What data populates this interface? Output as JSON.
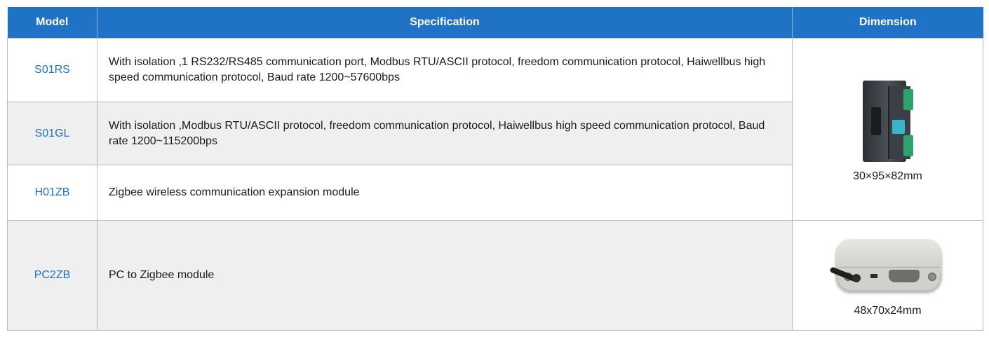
{
  "table": {
    "headers": {
      "model": "Model",
      "specification": "Specification",
      "dimension": "Dimension"
    },
    "rows": [
      {
        "model": "S01RS",
        "spec": "With isolation ,1 RS232/RS485 communication port, Modbus RTU/ASCII protocol, freedom communication protocol, Haiwellbus high speed communication protocol, Baud rate 1200~57600bps"
      },
      {
        "model": "S01GL",
        "spec": "With isolation ,Modbus RTU/ASCII protocol, freedom communication protocol, Haiwellbus high speed communication protocol, Baud rate 1200~115200bps"
      },
      {
        "model": "H01ZB",
        "spec": "Zigbee wireless communication expansion module"
      },
      {
        "model": "PC2ZB",
        "spec": "PC to Zigbee module"
      }
    ],
    "dimensions": [
      {
        "text": "30×95×82mm",
        "image": "din-rail-module-photo"
      },
      {
        "text": "48x70x24mm",
        "image": "pc-zigbee-gateway-photo"
      }
    ]
  },
  "colors": {
    "header_bg": "#1f72c6",
    "model_text": "#1f72c6",
    "alt_row_bg": "#efefef",
    "border": "#b8b8b8"
  }
}
